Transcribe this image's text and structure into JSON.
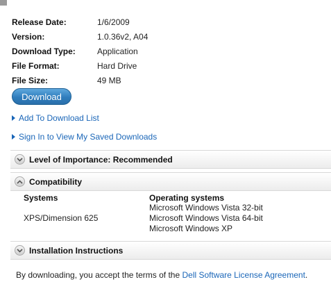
{
  "details": [
    {
      "label": "Release Date:",
      "value": "1/6/2009"
    },
    {
      "label": "Version:",
      "value": "1.0.36v2, A04"
    },
    {
      "label": "Download Type:",
      "value": "Application"
    },
    {
      "label": "File Format:",
      "value": "Hard Drive"
    },
    {
      "label": "File Size:",
      "value": "49 MB"
    }
  ],
  "download_button": "Download",
  "links": {
    "add_to_list": "Add To Download List",
    "sign_in": "Sign In to View My Saved Downloads"
  },
  "sections": {
    "importance": "Level of Importance: Recommended",
    "compatibility": "Compatibility",
    "installation": "Installation Instructions"
  },
  "compatibility": {
    "systems_header": "Systems",
    "os_header": "Operating systems",
    "system": "XPS/Dimension 625",
    "os": [
      "Microsoft Windows Vista 32-bit",
      "Microsoft Windows Vista 64-bit",
      "Microsoft Windows XP"
    ]
  },
  "footer": {
    "text": "By downloading, you accept the terms of the ",
    "link": "Dell Software License Agreement",
    "end": "."
  },
  "colors": {
    "link": "#1a66b8",
    "button": "#2f7dbd"
  }
}
